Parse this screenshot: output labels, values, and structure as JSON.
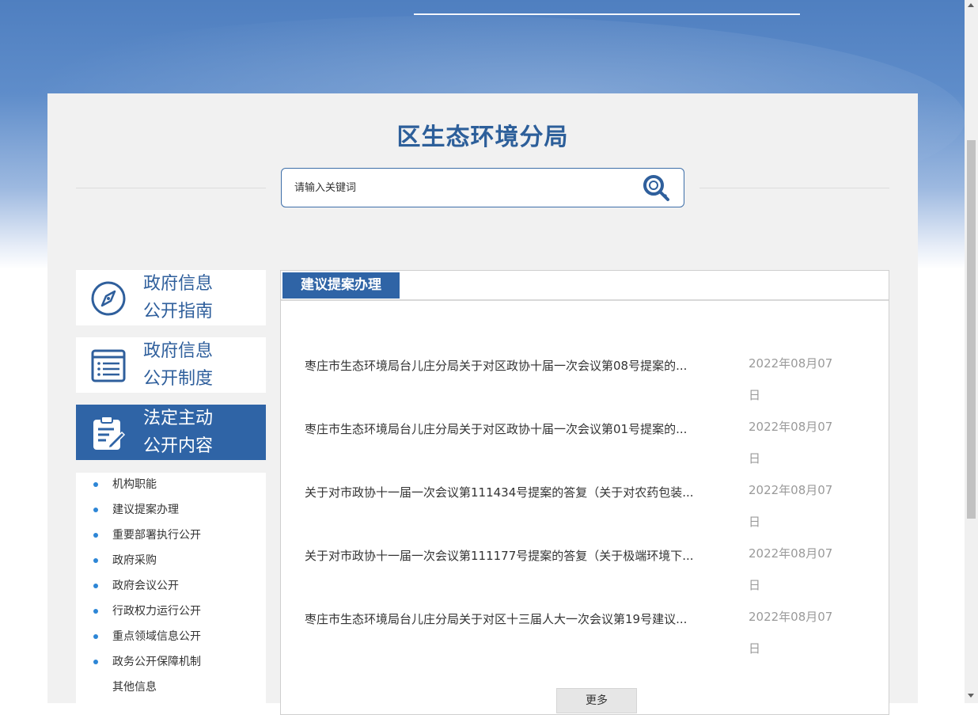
{
  "site": {
    "title": "区生态环境分局"
  },
  "search": {
    "placeholder": "请输入关键词"
  },
  "nav": {
    "cards": [
      {
        "line1": "政府信息",
        "line2": "公开指南",
        "icon": "compass-icon"
      },
      {
        "line1": "政府信息",
        "line2": "公开制度",
        "icon": "list-document-icon"
      },
      {
        "line1": "法定主动",
        "line2": "公开内容",
        "icon": "clipboard-edit-icon"
      }
    ],
    "sub_items": [
      "机构职能",
      "建议提案办理",
      "重要部署执行公开",
      "政府采购",
      "政府会议公开",
      "行政权力运行公开",
      "重点领域信息公开",
      "政务公开保障机制",
      "其他信息"
    ]
  },
  "content": {
    "tab_label": "建议提案办理",
    "items": [
      {
        "title": "枣庄市生态环境局台儿庄分局关于对区政协十届一次会议第08号提案的...",
        "date": "2022年08月07日"
      },
      {
        "title": "枣庄市生态环境局台儿庄分局关于对区政协十届一次会议第01号提案的...",
        "date": "2022年08月07日"
      },
      {
        "title": "关于对市政协十一届一次会议第111434号提案的答复（关于对农药包装...",
        "date": "2022年08月07日"
      },
      {
        "title": "关于对市政协十一届一次会议第111177号提案的答复（关于极端环境下...",
        "date": "2022年08月07日"
      },
      {
        "title": "枣庄市生态环境局台儿庄分局关于对区十三届人大一次会议第19号建议...",
        "date": "2022年08月07日"
      }
    ],
    "more_label": "更多"
  },
  "colors": {
    "primary": "#2f64a6",
    "title": "#2d5f9a",
    "bullet": "#2d86d6"
  }
}
